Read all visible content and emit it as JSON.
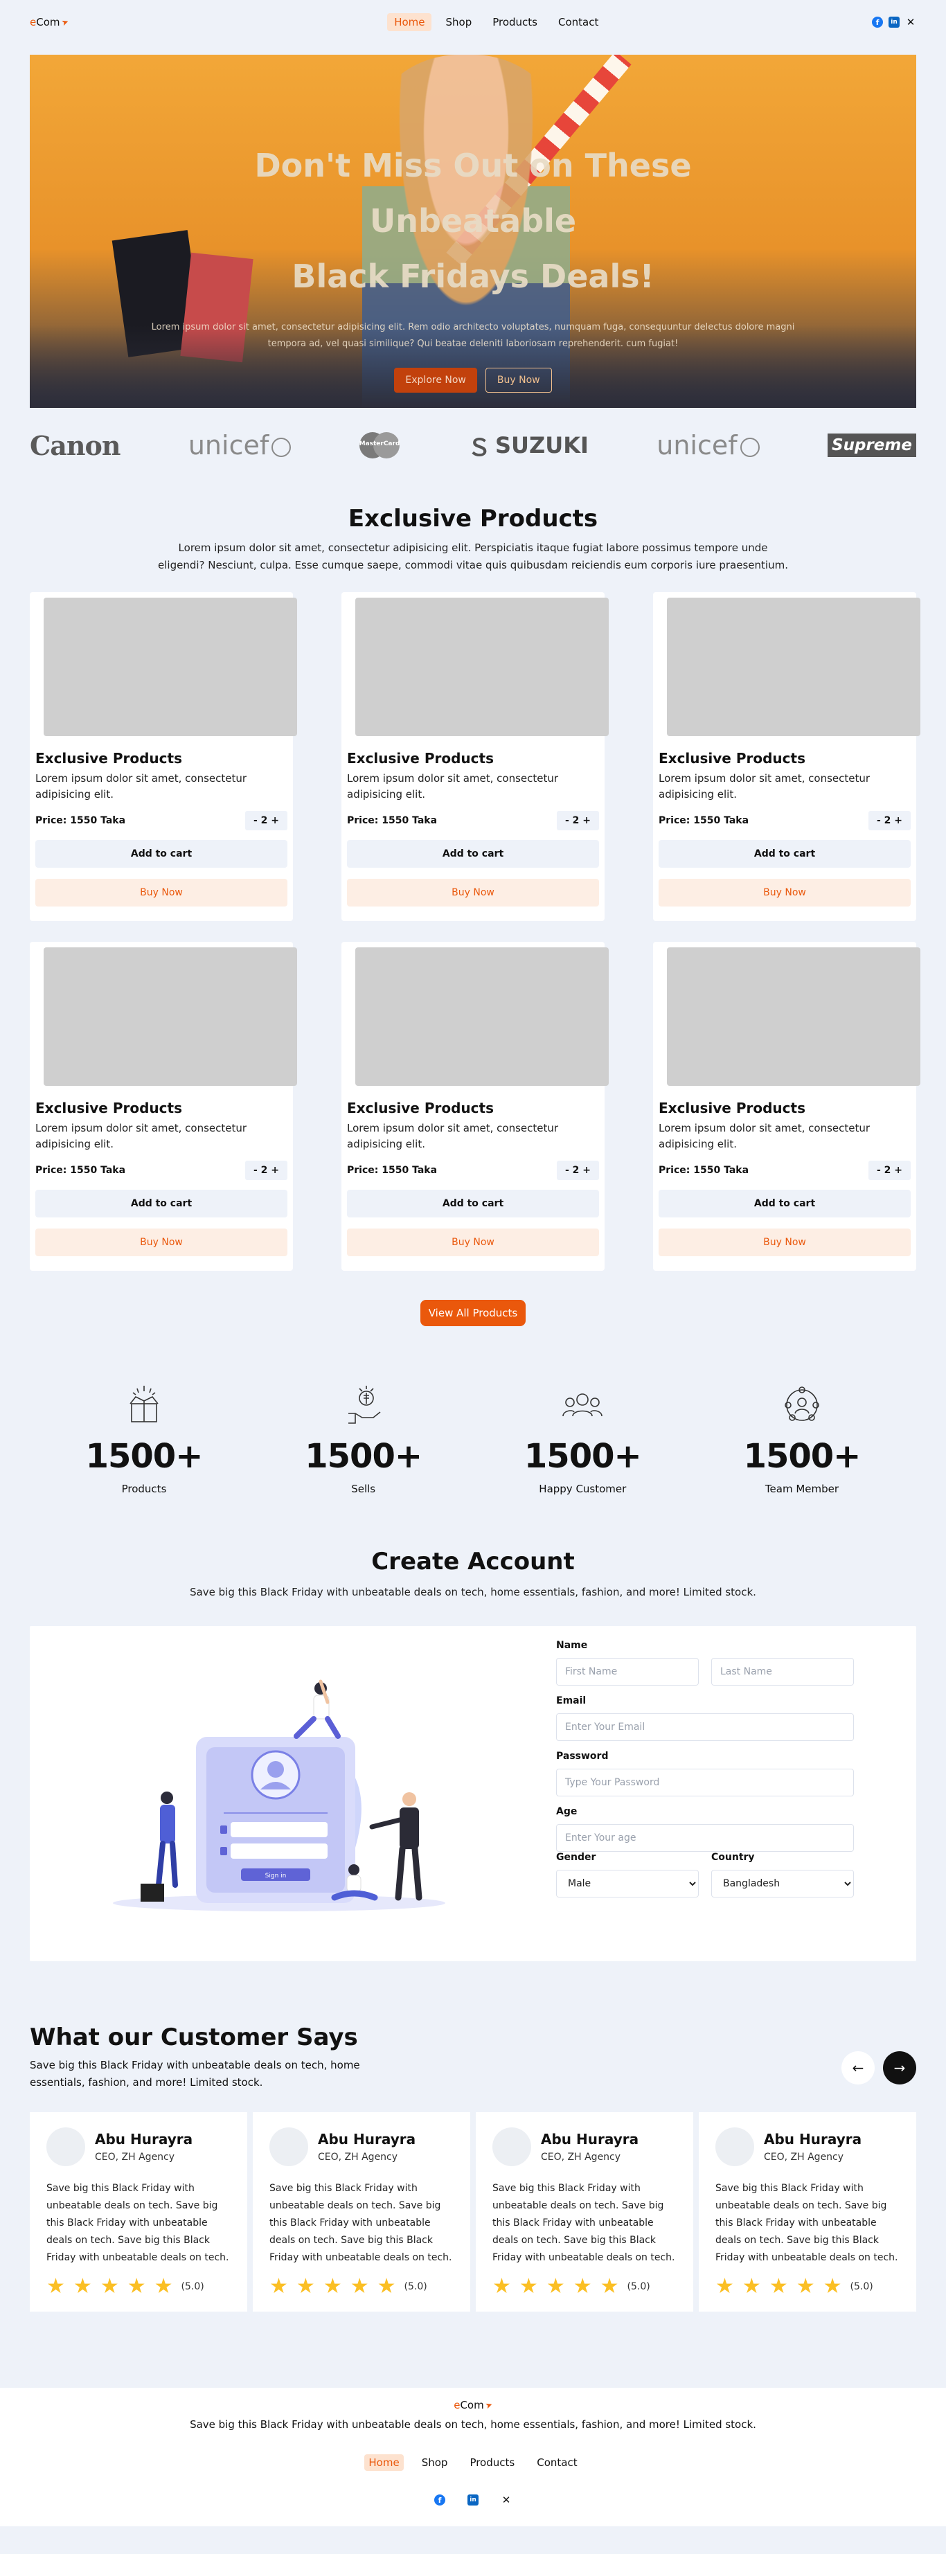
{
  "brand": {
    "logo_e": "e",
    "logo_rest": "Com"
  },
  "nav": {
    "items": [
      {
        "label": "Home"
      },
      {
        "label": "Shop"
      },
      {
        "label": "Products"
      },
      {
        "label": "Contact"
      }
    ]
  },
  "socials": {
    "facebook": "facebook-icon",
    "linkedin": "linkedin-icon",
    "x": "x-icon"
  },
  "hero": {
    "title_line1": "Don't Miss Out on These Unbeatable",
    "title_line2": "Black Fridays Deals!",
    "text": "Lorem ipsum dolor sit amet, consectetur adipisicing elit. Rem odio architecto voluptates, numquam fuga, consequuntur delectus dolore magni tempora ad, vel quasi similique? Qui beatae deleniti laboriosam reprehenderit. cum fugiat!",
    "primary_button": "Explore Now",
    "secondary_button": "Buy Now"
  },
  "brands": {
    "canon": "Canon",
    "unicef": "unicef",
    "mastercard": "MasterCard",
    "suzuki": "SUZUKI",
    "supreme": "Supreme"
  },
  "products_section": {
    "title": "Exclusive Products",
    "subtitle": "Lorem ipsum dolor sit amet, consectetur adipisicing elit. Perspiciatis itaque fugiat labore possimus tempore unde eligendi? Nesciunt, culpa. Esse cumque saepe, commodi vitae quis quibusdam reiciendis eum corporis iure praesentium.",
    "products": [
      {
        "title": "Exclusive Products",
        "desc": "Lorem ipsum dolor sit amet, consectetur adipisicing elit.",
        "price": "Price: 1550 Taka",
        "qty": "- 2 +",
        "cart": "Add to cart",
        "buy": "Buy Now"
      },
      {
        "title": "Exclusive Products",
        "desc": "Lorem ipsum dolor sit amet, consectetur adipisicing elit.",
        "price": "Price: 1550 Taka",
        "qty": "- 2 +",
        "cart": "Add to cart",
        "buy": "Buy Now"
      },
      {
        "title": "Exclusive Products",
        "desc": "Lorem ipsum dolor sit amet, consectetur adipisicing elit.",
        "price": "Price: 1550 Taka",
        "qty": "- 2 +",
        "cart": "Add to cart",
        "buy": "Buy Now"
      },
      {
        "title": "Exclusive Products",
        "desc": "Lorem ipsum dolor sit amet, consectetur adipisicing elit.",
        "price": "Price: 1550 Taka",
        "qty": "- 2 +",
        "cart": "Add to cart",
        "buy": "Buy Now"
      },
      {
        "title": "Exclusive Products",
        "desc": "Lorem ipsum dolor sit amet, consectetur adipisicing elit.",
        "price": "Price: 1550 Taka",
        "qty": "- 2 +",
        "cart": "Add to cart",
        "buy": "Buy Now"
      },
      {
        "title": "Exclusive Products",
        "desc": "Lorem ipsum dolor sit amet, consectetur adipisicing elit.",
        "price": "Price: 1550 Taka",
        "qty": "- 2 +",
        "cart": "Add to cart",
        "buy": "Buy Now"
      }
    ],
    "view_all": "View All Products"
  },
  "stats": [
    {
      "icon": "gift-box-icon",
      "value": "1500+",
      "label": "Products"
    },
    {
      "icon": "hand-sell-icon",
      "value": "1500+",
      "label": "Sells"
    },
    {
      "icon": "customers-icon",
      "value": "1500+",
      "label": "Happy Customer"
    },
    {
      "icon": "team-network-icon",
      "value": "1500+",
      "label": "Team Member"
    }
  ],
  "account": {
    "title": "Create Account",
    "subtitle": "Save big this Black Friday with unbeatable deals on tech, home essentials, fashion, and more! Limited stock.",
    "name_label": "Name",
    "first_name_placeholder": "First Name",
    "last_name_placeholder": "Last Name",
    "email_label": "Email",
    "email_placeholder": "Enter Your Email",
    "password_label": "Password",
    "password_placeholder": "Type Your Password",
    "age_label": "Age",
    "age_placeholder": "Enter Your age",
    "gender_label": "Gender",
    "gender_value": "Male",
    "country_label": "Country",
    "country_value": "Bangladesh",
    "illus_signin": "Sign in"
  },
  "testimonials": {
    "title": "What our Customer Says",
    "subtitle": "Save big this Black Friday with unbeatable deals on tech, home essentials, fashion, and more! Limited stock.",
    "items": [
      {
        "name": "Abu Hurayra",
        "role": "CEO, ZH Agency",
        "text": "Save big this Black Friday with unbeatable deals on tech. Save big this Black Friday with unbeatable deals on tech. Save big this Black Friday with unbeatable deals on tech.",
        "rating": "(5.0)"
      },
      {
        "name": "Abu Hurayra",
        "role": "CEO, ZH Agency",
        "text": "Save big this Black Friday with unbeatable deals on tech. Save big this Black Friday with unbeatable deals on tech. Save big this Black Friday with unbeatable deals on tech.",
        "rating": "(5.0)"
      },
      {
        "name": "Abu Hurayra",
        "role": "CEO, ZH Agency",
        "text": "Save big this Black Friday with unbeatable deals on tech. Save big this Black Friday with unbeatable deals on tech. Save big this Black Friday with unbeatable deals on tech.",
        "rating": "(5.0)"
      },
      {
        "name": "Abu Hurayra",
        "role": "CEO, ZH Agency",
        "text": "Save big this Black Friday with unbeatable deals on tech. Save big this Black Friday with unbeatable deals on tech. Save big this Black Friday with unbeatable deals on tech.",
        "rating": "(5.0)"
      }
    ]
  },
  "footer": {
    "text": "Save big this Black Friday with unbeatable deals on tech, home essentials, fashion, and more! Limited stock.",
    "menu": [
      {
        "label": "Home"
      },
      {
        "label": "Shop"
      },
      {
        "label": "Products"
      },
      {
        "label": "Contact"
      }
    ]
  },
  "colors": {
    "accent": "#ea580c",
    "accent_soft": "#fde2cf",
    "page_bg": "#eef2f9",
    "star": "#fbbf24"
  }
}
